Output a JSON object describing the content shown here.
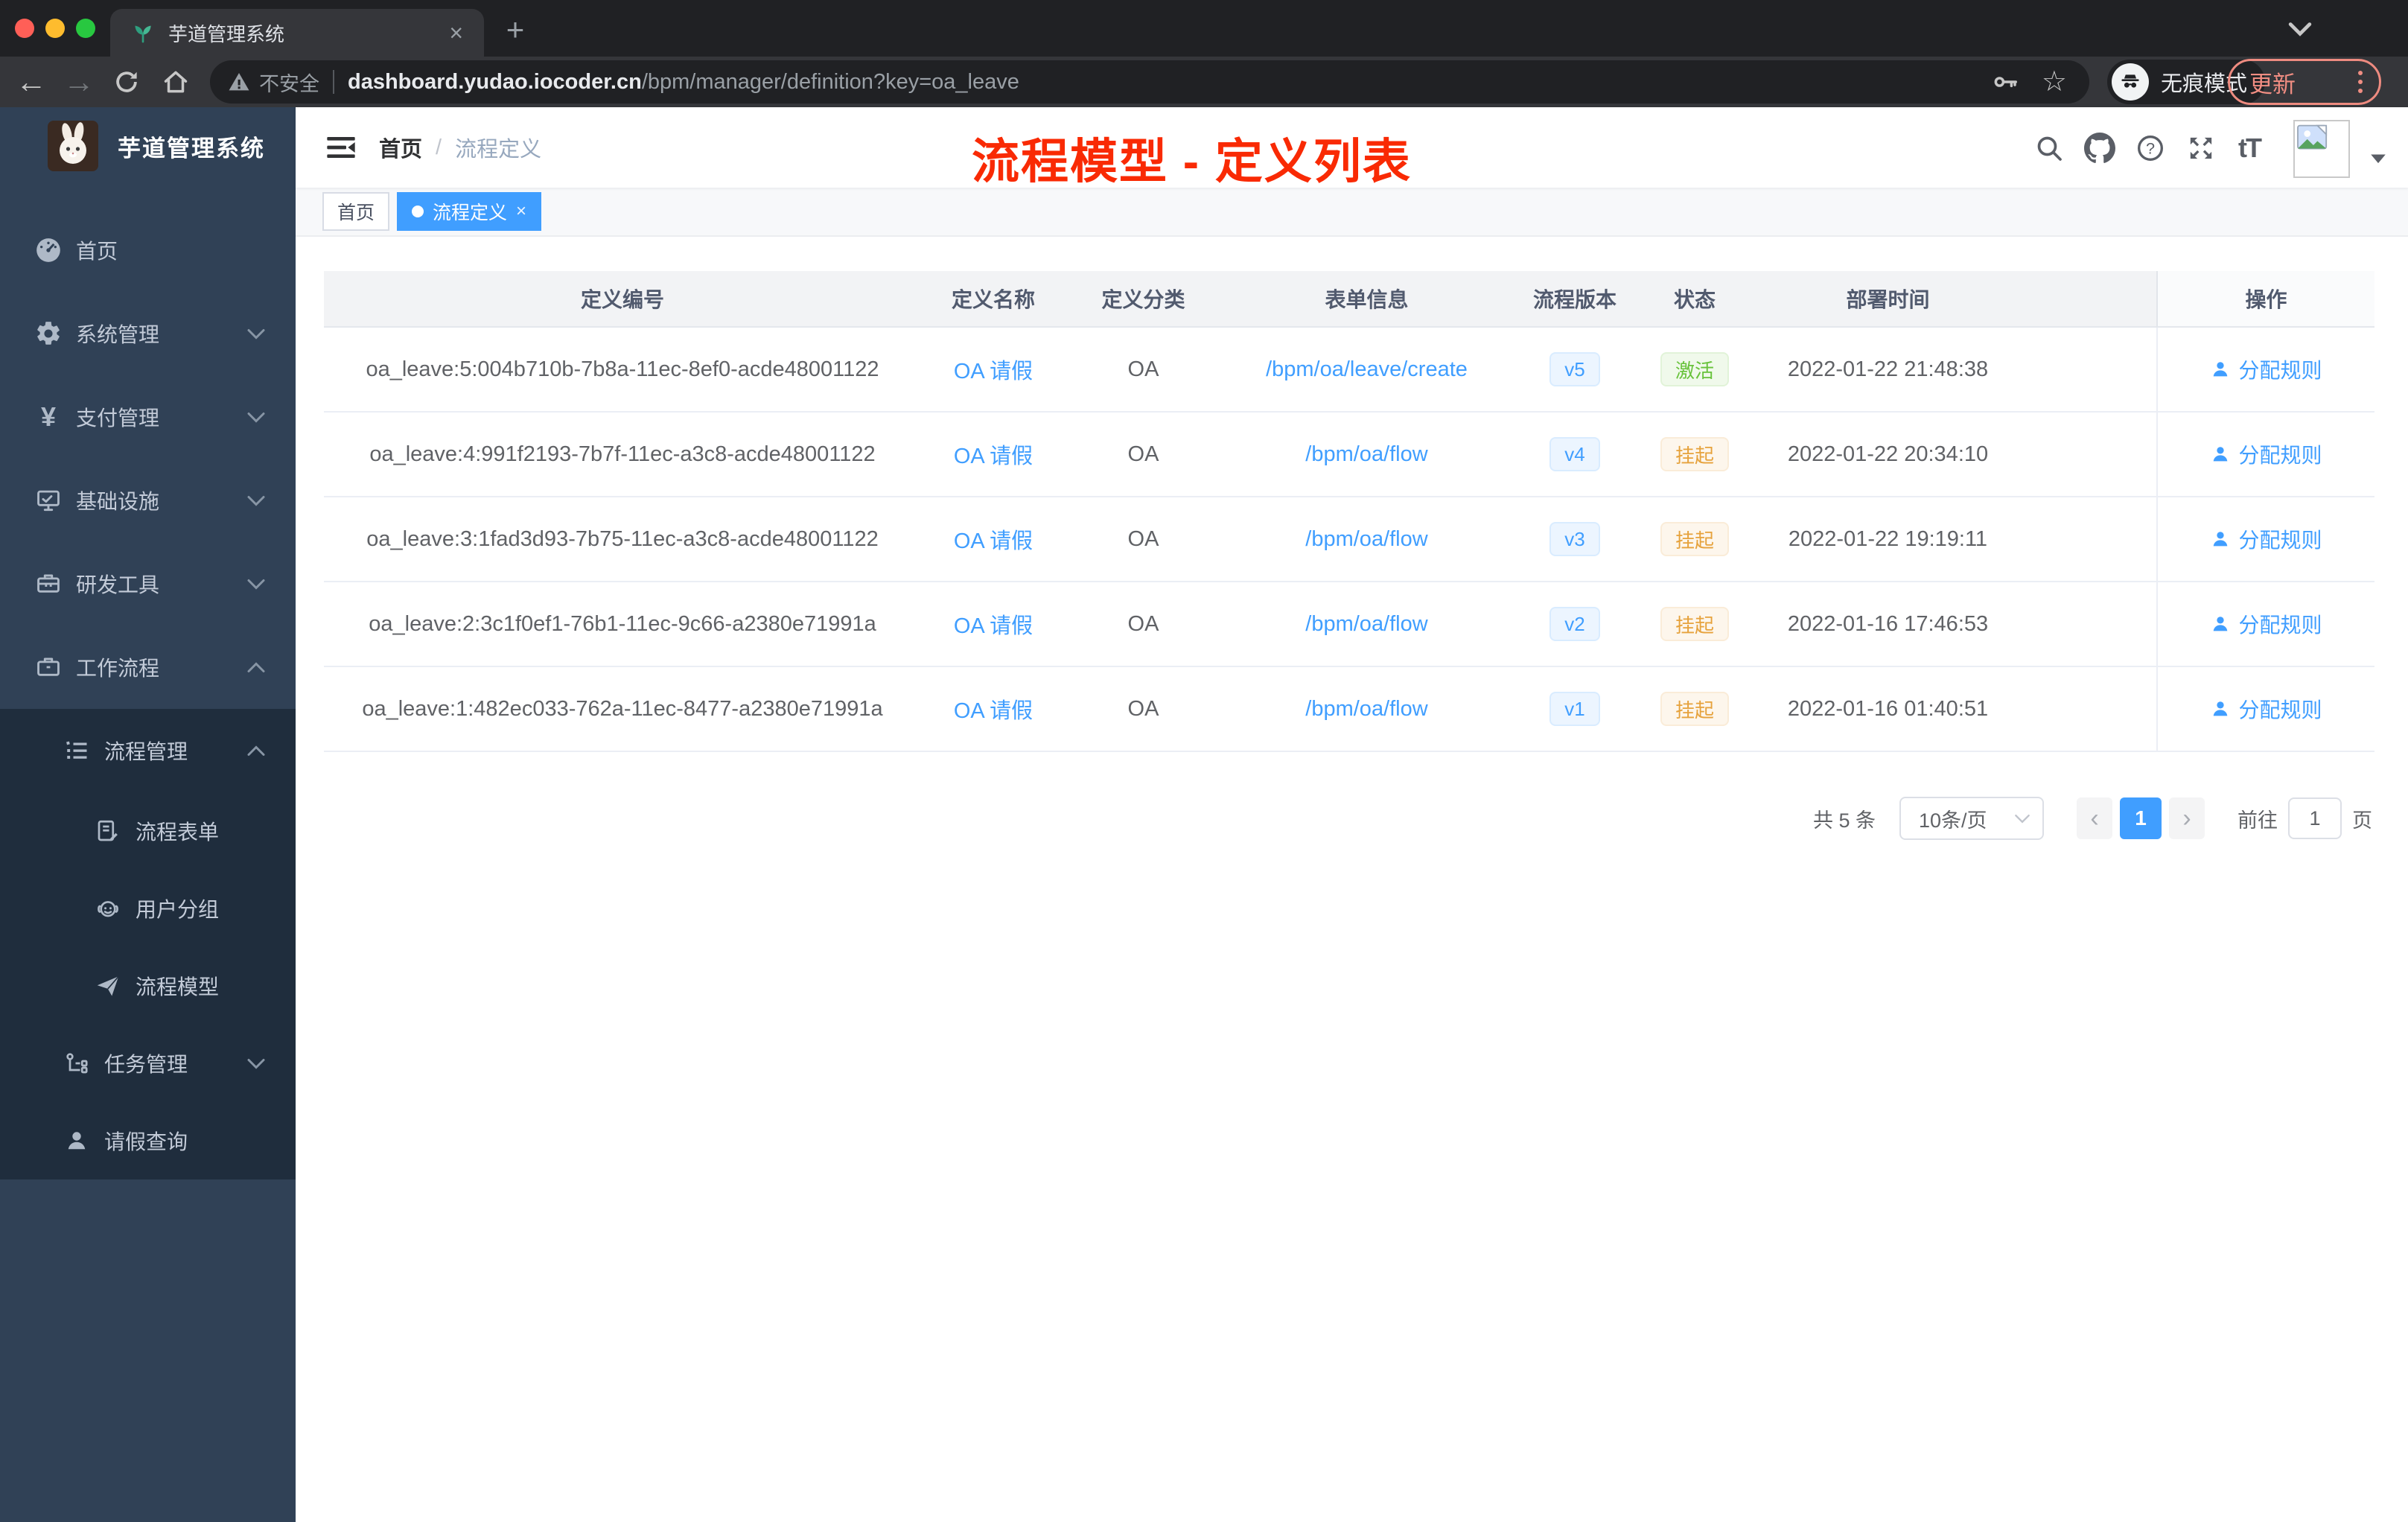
{
  "browser": {
    "tab_title": "芋道管理系统",
    "tab_close": "×",
    "new_tab": "+",
    "back_glyph": "←",
    "forward_glyph": "→",
    "security_label": "不安全",
    "url_host": "dashboard.yudao.iocoder.cn",
    "url_path": "/bpm/manager/definition?key=oa_leave",
    "star_glyph": "☆",
    "incognito_label": "无痕模式",
    "update_label": "更新"
  },
  "sidebar": {
    "logo_title": "芋道管理系统",
    "items": [
      {
        "label": "首页",
        "icon": "dashboard-icon"
      },
      {
        "label": "系统管理",
        "icon": "gear-icon"
      },
      {
        "label": "支付管理",
        "icon": "yen-icon"
      },
      {
        "label": "基础设施",
        "icon": "monitor-icon"
      },
      {
        "label": "研发工具",
        "icon": "toolbox-icon"
      },
      {
        "label": "工作流程",
        "icon": "briefcase-icon"
      },
      {
        "label": "流程管理",
        "icon": "list-icon"
      },
      {
        "label": "流程表单",
        "icon": "form-edit-icon"
      },
      {
        "label": "用户分组",
        "icon": "robot-icon"
      },
      {
        "label": "流程模型",
        "icon": "paper-plane-icon"
      },
      {
        "label": "任务管理",
        "icon": "tree-icon"
      },
      {
        "label": "请假查询",
        "icon": "user-icon"
      }
    ],
    "yen_glyph": "¥"
  },
  "header": {
    "breadcrumb_home": "首页",
    "breadcrumb_sep": "/",
    "breadcrumb_current": "流程定义",
    "annotation": "流程模型 - 定义列表",
    "font_icon_label": "tT"
  },
  "tags_view": {
    "close_glyph": "×",
    "tags": [
      {
        "label": "首页"
      },
      {
        "label": "流程定义"
      }
    ]
  },
  "table": {
    "columns": {
      "id": "定义编号",
      "name": "定义名称",
      "category": "定义分类",
      "form": "表单信息",
      "version": "流程版本",
      "status": "状态",
      "time": "部署时间",
      "action": "操作"
    },
    "rows": [
      {
        "id": "oa_leave:5:004b710b-7b8a-11ec-8ef0-acde48001122",
        "name": "OA 请假",
        "category": "OA",
        "form": "/bpm/oa/leave/create",
        "version": "v5",
        "status": "激活",
        "status_type": "success",
        "time": "2022-01-22 21:48:38",
        "action": "分配规则"
      },
      {
        "id": "oa_leave:4:991f2193-7b7f-11ec-a3c8-acde48001122",
        "name": "OA 请假",
        "category": "OA",
        "form": "/bpm/oa/flow",
        "version": "v4",
        "status": "挂起",
        "status_type": "warning",
        "time": "2022-01-22 20:34:10",
        "action": "分配规则"
      },
      {
        "id": "oa_leave:3:1fad3d93-7b75-11ec-a3c8-acde48001122",
        "name": "OA 请假",
        "category": "OA",
        "form": "/bpm/oa/flow",
        "version": "v3",
        "status": "挂起",
        "status_type": "warning",
        "time": "2022-01-22 19:19:11",
        "action": "分配规则"
      },
      {
        "id": "oa_leave:2:3c1f0ef1-76b1-11ec-9c66-a2380e71991a",
        "name": "OA 请假",
        "category": "OA",
        "form": "/bpm/oa/flow",
        "version": "v2",
        "status": "挂起",
        "status_type": "warning",
        "time": "2022-01-16 17:46:53",
        "action": "分配规则"
      },
      {
        "id": "oa_leave:1:482ec033-762a-11ec-8477-a2380e71991a",
        "name": "OA 请假",
        "category": "OA",
        "form": "/bpm/oa/flow",
        "version": "v1",
        "status": "挂起",
        "status_type": "warning",
        "time": "2022-01-16 01:40:51",
        "action": "分配规则"
      }
    ]
  },
  "pagination": {
    "total": "共 5 条",
    "page_size": "10条/页",
    "prev_glyph": "‹",
    "current_page": "1",
    "next_glyph": "›",
    "goto_label": "前往",
    "goto_value": "1",
    "goto_suffix": "页"
  },
  "colors": {
    "accent_blue": "#409eff",
    "success_green": "#67c23a",
    "warning_yellow": "#e6a23c",
    "annotation_red": "#f92a04",
    "sidebar_bg": "#304156",
    "submenu_bg": "#1f2d3d"
  },
  "icons": {
    "tab_favicon": "plant",
    "security": "warning-triangle",
    "header_right": [
      "search",
      "github",
      "help",
      "fullscreen",
      "font-size",
      "avatar",
      "caret-down"
    ],
    "row_action": "person"
  }
}
